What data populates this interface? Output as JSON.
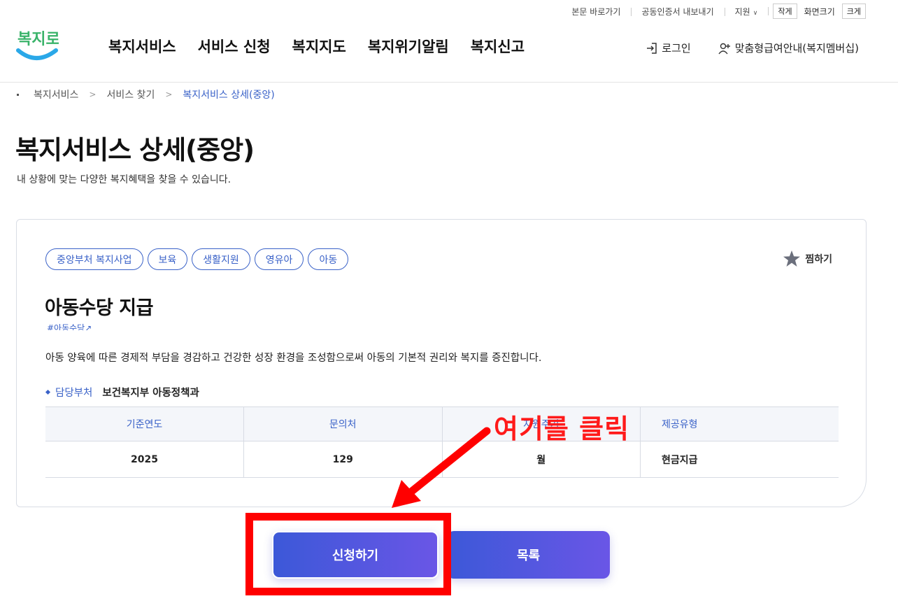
{
  "utility": {
    "skip_link": "본문 바로가기",
    "cert_export": "공동인증서 내보내기",
    "support": "지원",
    "font_small": "작게",
    "font_label": "화면크기",
    "font_large": "크게"
  },
  "header": {
    "logo_text": "복지로",
    "nav": [
      "복지서비스",
      "서비스 신청",
      "복지지도",
      "복지위기알림",
      "복지신고"
    ],
    "login": "로그인",
    "membership": "맞춤형급여안내(복지멤버십)"
  },
  "breadcrumb": [
    "복지서비스",
    "서비스 찾기",
    "복지서비스 상세(중앙)"
  ],
  "page": {
    "title": "복지서비스 상세(중앙)",
    "description": "내 상황에 맞는 다양한 복지혜택을 찾을 수 있습니다."
  },
  "service": {
    "tags": [
      "중앙부처 복지사업",
      "보육",
      "생활지원",
      "영유아",
      "아동"
    ],
    "favorite_label": "찜하기",
    "title": "아동수당 지급",
    "hashtag": "#아동수당",
    "description": "아동 양육에 따른 경제적 부담을 경감하고 건강한 성장 환경을 조성함으로써 아동의 기본적 권리와 복지를 증진합니다.",
    "dept_label": "담당부처",
    "dept_value": "보건복지부 아동정책과",
    "table": {
      "headers": [
        "기준연도",
        "문의처",
        "지원주기",
        "제공유형"
      ],
      "row": [
        "2025",
        "129",
        "월",
        "현금지급"
      ]
    }
  },
  "buttons": {
    "apply": "신청하기",
    "list": "목록"
  },
  "annotation": {
    "text": "여기를 클릭",
    "color": "#ff0000"
  },
  "colors": {
    "accent": "#3a62c8",
    "button_gradient_start": "#3c58d8",
    "button_gradient_end": "#6a56e6"
  }
}
